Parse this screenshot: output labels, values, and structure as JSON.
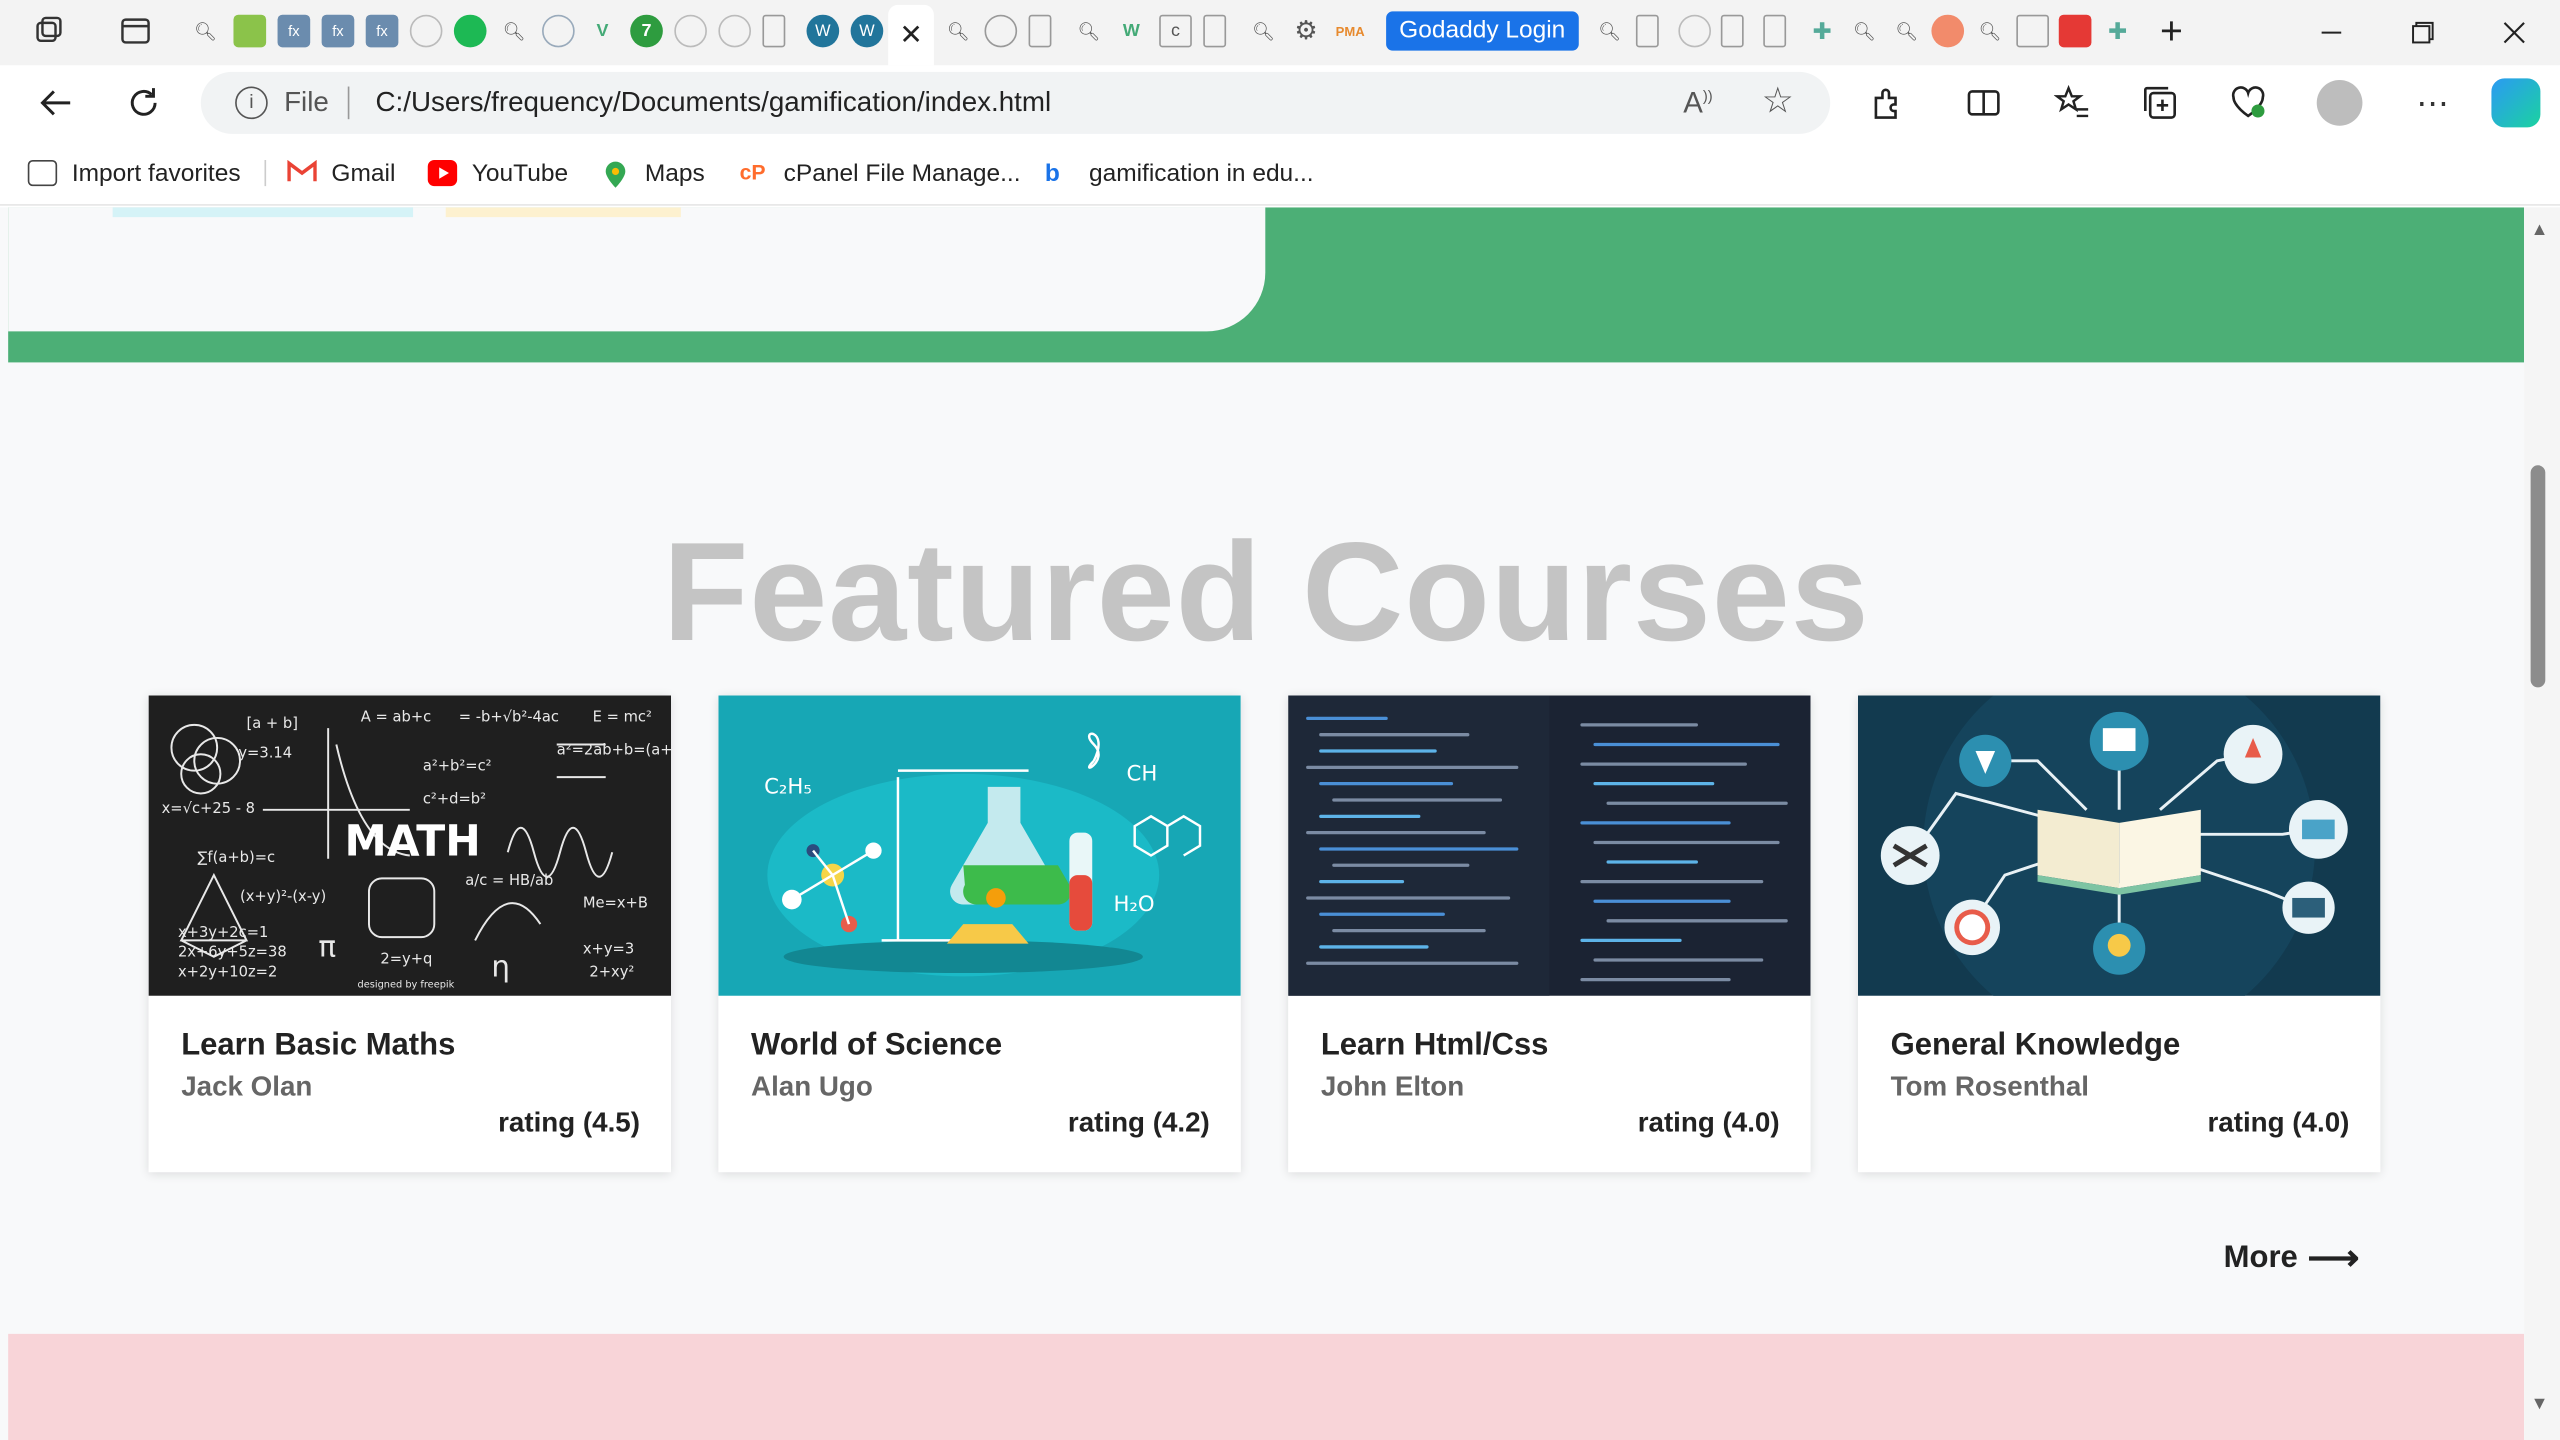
{
  "browser": {
    "tab_group_label": "Godaddy Login",
    "active_tab_close": "✕",
    "new_tab": "+",
    "url_scheme": "File",
    "url": "C:/Users/frequency/Documents/gamification/index.html",
    "bookmarks": [
      {
        "label": "Import favorites",
        "color": "#444444"
      },
      {
        "label": "Gmail",
        "color": "#ea4335"
      },
      {
        "label": "YouTube",
        "color": "#ff0000"
      },
      {
        "label": "Maps",
        "color": "#34a853"
      },
      {
        "label": "cPanel File Manage...",
        "color": "#ff6c2c"
      },
      {
        "label": "gamification in edu...",
        "color": "#1a73e8"
      }
    ]
  },
  "page": {
    "section_title": "Featured Courses",
    "more_label": "More",
    "courses": [
      {
        "title": "Learn Basic Maths",
        "author": "Jack Olan",
        "rating": "rating (4.5)",
        "image": "math-chalkboard",
        "image_text": "MATH"
      },
      {
        "title": "World of Science",
        "author": "Alan Ugo",
        "rating": "rating (4.2)",
        "image": "science-lab",
        "image_text": "CH"
      },
      {
        "title": "Learn Html/Css",
        "author": "John Elton",
        "rating": "rating (4.0)",
        "image": "code-screen",
        "image_text": ""
      },
      {
        "title": "General Knowledge",
        "author": "Tom Rosenthal",
        "rating": "rating (4.0)",
        "image": "book-network",
        "image_text": ""
      }
    ]
  },
  "colors": {
    "green_band": "#4caf76",
    "pink_section": "#f8d4d8",
    "title_gray": "#c4c4c4",
    "tab_group": "#1a73e8"
  }
}
